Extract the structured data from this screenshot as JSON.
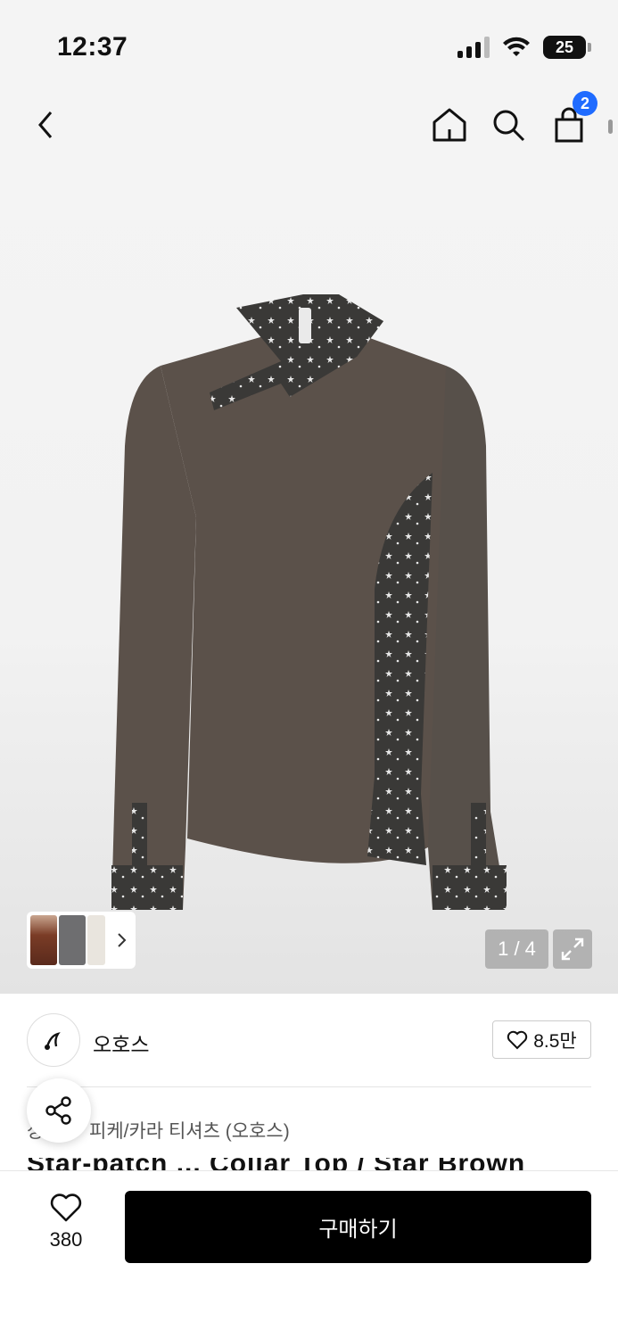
{
  "status_bar": {
    "time": "12:37",
    "battery": "25"
  },
  "nav": {
    "cart_count": "2",
    "icons": [
      "back-icon",
      "home-icon",
      "search-icon",
      "cart-icon"
    ]
  },
  "gallery": {
    "pager": "1 / 4",
    "image_colors": {
      "body": "#5b514a",
      "print": "#3a3937"
    }
  },
  "brand": {
    "name": "오호스",
    "likes": "8.5만"
  },
  "product": {
    "category_prefix": "상",
    "category": "피케/카라 티셔츠 (오호스)",
    "title": "Star-patch ... Collar Top / Star Brown"
  },
  "bottom_bar": {
    "wish_count": "380",
    "buy_label": "구매하기"
  },
  "colors": {
    "accent": "#1f6bff",
    "buy_button": "#000000"
  }
}
